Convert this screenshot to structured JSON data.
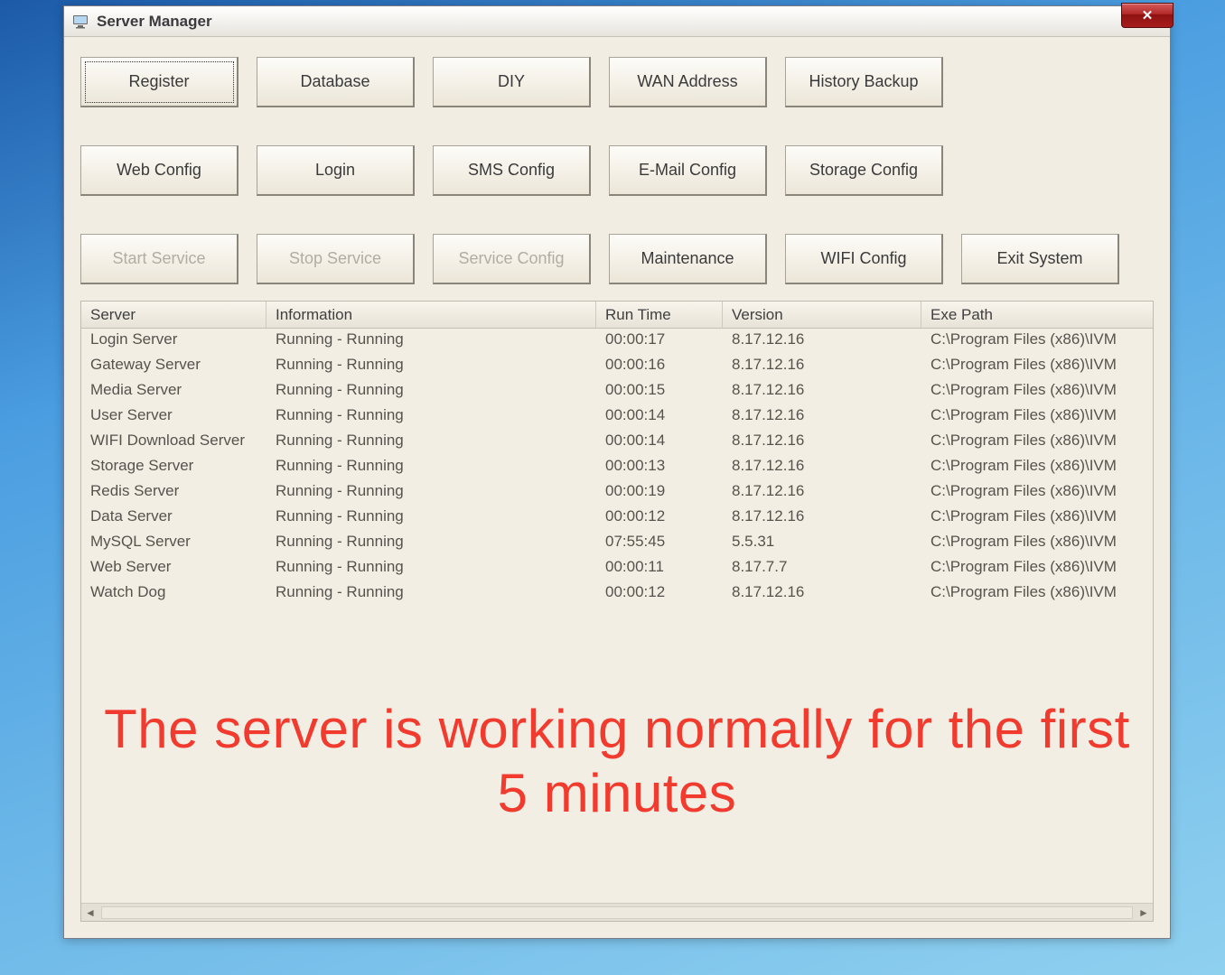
{
  "window": {
    "title": "Server Manager",
    "close_glyph": "✕"
  },
  "buttons": {
    "row1": [
      {
        "id": "register-button",
        "label": "Register",
        "disabled": false,
        "focused": true
      },
      {
        "id": "database-button",
        "label": "Database",
        "disabled": false
      },
      {
        "id": "diy-button",
        "label": "DIY",
        "disabled": false
      },
      {
        "id": "wan-address-button",
        "label": "WAN Address",
        "disabled": false
      },
      {
        "id": "history-backup-button",
        "label": "History Backup",
        "disabled": false
      }
    ],
    "row2": [
      {
        "id": "web-config-button",
        "label": "Web Config",
        "disabled": false
      },
      {
        "id": "login-button",
        "label": "Login",
        "disabled": false
      },
      {
        "id": "sms-config-button",
        "label": "SMS Config",
        "disabled": false
      },
      {
        "id": "email-config-button",
        "label": "E-Mail Config",
        "disabled": false
      },
      {
        "id": "storage-config-button",
        "label": "Storage Config",
        "disabled": false
      }
    ],
    "row3": [
      {
        "id": "start-service-button",
        "label": "Start Service",
        "disabled": true
      },
      {
        "id": "stop-service-button",
        "label": "Stop Service",
        "disabled": true
      },
      {
        "id": "service-config-button",
        "label": "Service Config",
        "disabled": true
      },
      {
        "id": "maintenance-button",
        "label": "Maintenance",
        "disabled": false
      },
      {
        "id": "wifi-config-button",
        "label": "WIFI Config",
        "disabled": false
      },
      {
        "id": "exit-system-button",
        "label": "Exit System",
        "disabled": false
      }
    ]
  },
  "listview": {
    "headers": {
      "server": "Server",
      "information": "Information",
      "runtime": "Run Time",
      "version": "Version",
      "exepath": "Exe Path"
    },
    "rows": [
      {
        "server": "Login Server",
        "info": "Running - Running",
        "runtime": "00:00:17",
        "version": "8.17.12.16",
        "path": "C:\\Program Files (x86)\\IVM"
      },
      {
        "server": "Gateway Server",
        "info": "Running - Running",
        "runtime": "00:00:16",
        "version": "8.17.12.16",
        "path": "C:\\Program Files (x86)\\IVM"
      },
      {
        "server": "Media Server",
        "info": "Running - Running",
        "runtime": "00:00:15",
        "version": "8.17.12.16",
        "path": "C:\\Program Files (x86)\\IVM"
      },
      {
        "server": "User Server",
        "info": "Running - Running",
        "runtime": "00:00:14",
        "version": "8.17.12.16",
        "path": "C:\\Program Files (x86)\\IVM"
      },
      {
        "server": "WIFI Download Server",
        "info": "Running - Running",
        "runtime": "00:00:14",
        "version": "8.17.12.16",
        "path": "C:\\Program Files (x86)\\IVM"
      },
      {
        "server": "Storage Server",
        "info": "Running - Running",
        "runtime": "00:00:13",
        "version": "8.17.12.16",
        "path": "C:\\Program Files (x86)\\IVM"
      },
      {
        "server": "Redis Server",
        "info": "Running - Running",
        "runtime": "00:00:19",
        "version": "8.17.12.16",
        "path": "C:\\Program Files (x86)\\IVM"
      },
      {
        "server": "Data Server",
        "info": "Running - Running",
        "runtime": "00:00:12",
        "version": "8.17.12.16",
        "path": "C:\\Program Files (x86)\\IVM"
      },
      {
        "server": "MySQL Server",
        "info": "Running - Running",
        "runtime": "07:55:45",
        "version": "5.5.31",
        "path": "C:\\Program Files (x86)\\IVM"
      },
      {
        "server": "Web Server",
        "info": "Running - Running",
        "runtime": "00:00:11",
        "version": "8.17.7.7",
        "path": "C:\\Program Files (x86)\\IVM"
      },
      {
        "server": "Watch Dog",
        "info": "Running - Running",
        "runtime": "00:00:12",
        "version": "8.17.12.16",
        "path": "C:\\Program Files (x86)\\IVM"
      }
    ]
  },
  "overlay": {
    "text": "The server is working normally for the first 5 minutes"
  },
  "scroll": {
    "left_glyph": "◄",
    "right_glyph": "►"
  }
}
